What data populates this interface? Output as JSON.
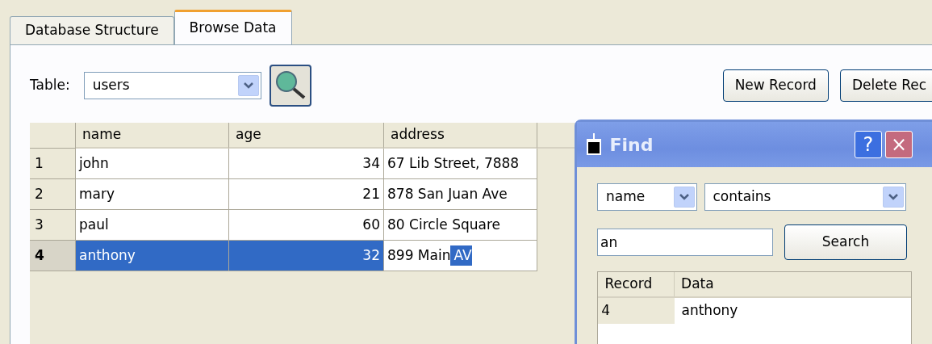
{
  "tabs": [
    {
      "label": "Database Structure",
      "selected": false
    },
    {
      "label": "Browse Data",
      "selected": true
    }
  ],
  "toolbar": {
    "table_label": "Table:",
    "table_select": "users",
    "buttons": [
      "New Record",
      "Delete Rec"
    ]
  },
  "grid": {
    "columns": [
      "name",
      "age",
      "address"
    ],
    "rows": [
      {
        "number": "1",
        "name": "john",
        "age": "34",
        "address": "67 Lib Street, 7888",
        "selected": false
      },
      {
        "number": "2",
        "name": "mary",
        "age": "21",
        "address": "878 San Juan Ave",
        "selected": false
      },
      {
        "number": "3",
        "name": "paul",
        "age": "60",
        "address": "80 Circle Square",
        "selected": false
      },
      {
        "number": "4",
        "name": "anthony",
        "age": "32",
        "address": "899 Main",
        "address_selected_text": "AV",
        "selected": true
      }
    ]
  },
  "find_dialog": {
    "title": "Find",
    "help_button": "?",
    "close_button": "×",
    "field_select": "name",
    "operator_select": "contains",
    "search_value": "an",
    "search_button": "Search",
    "results": {
      "columns": [
        "Record",
        "Data"
      ],
      "rows": [
        {
          "record": "4",
          "data": "anthony"
        }
      ]
    }
  }
}
